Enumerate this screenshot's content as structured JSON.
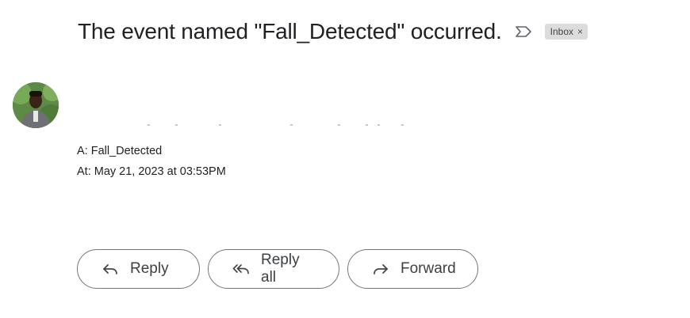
{
  "email": {
    "subject": "The event named \"Fall_Detected\" occurred.",
    "label": "Inbox",
    "label_remove": "×",
    "meta_to": "A: Fall_Detected",
    "meta_time": "At: May 21, 2023 at 03:53PM"
  },
  "actions": {
    "reply_label": "Reply",
    "reply_all_label": "Reply all",
    "forward_label": "Forward"
  },
  "icons": {
    "important": "important-marker-icon",
    "reply": "reply-arrow-icon",
    "reply_all": "reply-all-arrow-icon",
    "forward": "forward-arrow-icon"
  },
  "colors": {
    "text": "#202124",
    "chip_bg": "#dcdcdc",
    "button_border": "#747775"
  }
}
